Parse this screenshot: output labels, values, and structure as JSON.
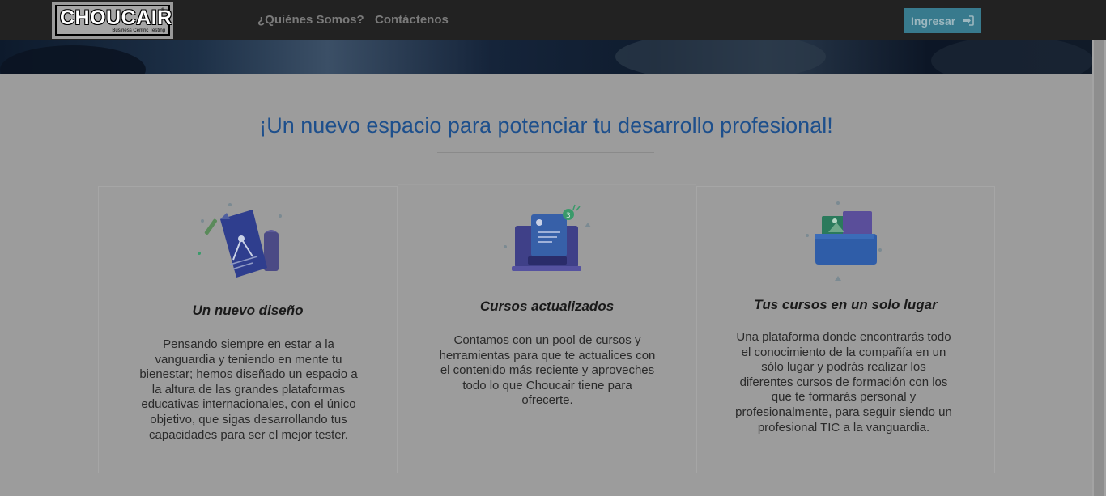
{
  "navbar": {
    "logo": {
      "brand": "CHOUCAIR",
      "tagline": "Business Centric Testing",
      "registered": "®"
    },
    "links": [
      {
        "label": "¿Quiénes Somos?"
      },
      {
        "label": "Contáctenos"
      }
    ],
    "login_button": {
      "label": "Ingresar",
      "icon": "sign-in-icon"
    }
  },
  "headline": "¡Un nuevo espacio para potenciar tu desarrollo profesional!",
  "cards": [
    {
      "icon": "design-compass-document-icon",
      "title": "Un nuevo diseño",
      "text": "Pensando siempre en estar a la vanguardia y teniendo en mente tu bienestar; hemos diseñado un espacio a la altura de las grandes plataformas educativas internacionales, con el único objetivo, que sigas desarrollando tus capacidades para ser el mejor tester."
    },
    {
      "icon": "laptop-courses-icon",
      "title": "Cursos actualizados",
      "text": "Contamos con un pool de cursos y herramientas para que te actualices con el contenido más reciente y aproveches todo lo que Choucair tiene para ofrecerte."
    },
    {
      "icon": "folder-icon",
      "title": "Tus cursos en un solo lugar",
      "text": "Una plataforma donde encontrarás todo el conocimiento de la compañía en un sólo lugar y podrás realizar los diferentes cursos de formación con los que te formarás personal y profesionalmente, para seguir siendo un profesional TIC a la vanguardia."
    }
  ],
  "colors": {
    "navbar": "#222222",
    "headline": "#1d4f8c",
    "login_button": "#387a8d",
    "overlay_background": "#9c9c9c"
  }
}
